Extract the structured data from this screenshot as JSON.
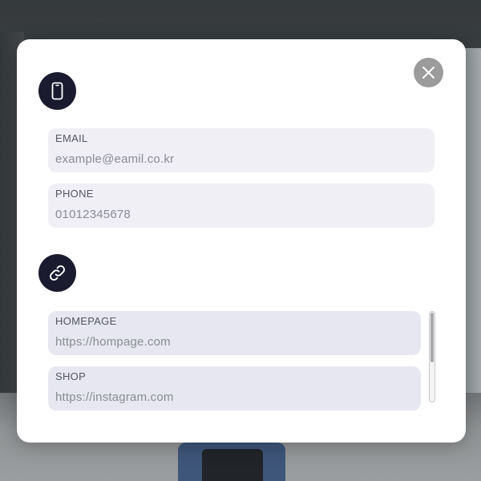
{
  "contact": {
    "icon": "phone-icon",
    "email": {
      "label": "EMAIL",
      "placeholder": "example@eamil.co.kr"
    },
    "phone": {
      "label": "PHONE",
      "placeholder": "01012345678"
    }
  },
  "links": {
    "icon": "link-icon",
    "homepage": {
      "label": "HOMEPAGE",
      "placeholder": "https://hompage.com"
    },
    "shop": {
      "label": "SHOP",
      "placeholder": "https://instagram.com"
    }
  },
  "close": {
    "icon": "close-icon"
  },
  "colors": {
    "icon_badge": "#1a1b2e",
    "close_button": "#9b9b9b",
    "field_background": "#efeff5",
    "modal_background": "#ffffff"
  }
}
